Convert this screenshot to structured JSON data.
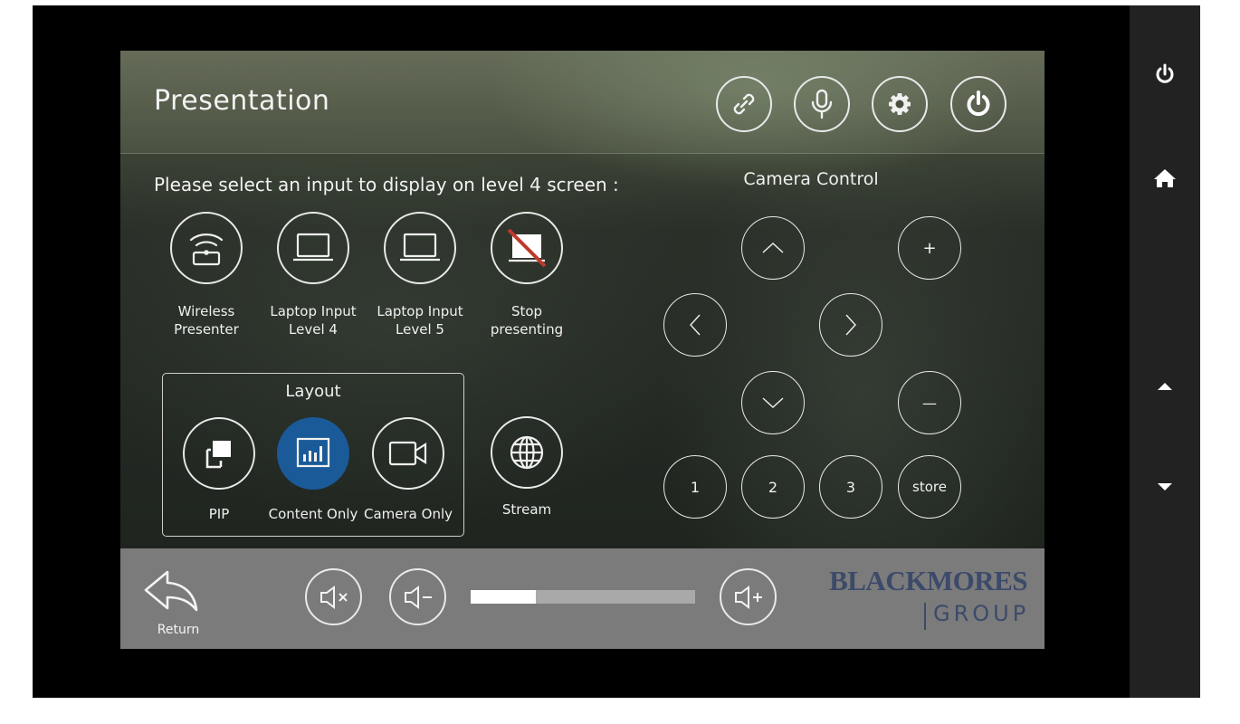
{
  "header": {
    "title": "Presentation"
  },
  "prompt": "Please select an input to display on level 4 screen :",
  "inputs": [
    {
      "label": "Wireless\nPresenter"
    },
    {
      "label": "Laptop Input\nLevel 4"
    },
    {
      "label": "Laptop Input\nLevel 5"
    },
    {
      "label": "Stop\npresenting"
    }
  ],
  "layout": {
    "title": "Layout",
    "options": [
      {
        "label": "PIP",
        "selected": false
      },
      {
        "label": "Content Only",
        "selected": true
      },
      {
        "label": "Camera Only",
        "selected": false
      }
    ]
  },
  "stream": {
    "label": "Stream"
  },
  "camera": {
    "title": "Camera Control",
    "zoom_in": "+",
    "zoom_out": "—",
    "presets": [
      "1",
      "2",
      "3"
    ],
    "store": "store"
  },
  "footer": {
    "return_label": "Return",
    "volume_level": 0.29,
    "brand_top": "BLACKMORES",
    "brand_bottom": "GROUP"
  },
  "colors": {
    "selected": "#1a5a99",
    "footer": "#7b7b7b",
    "sidebar": "#222222"
  }
}
